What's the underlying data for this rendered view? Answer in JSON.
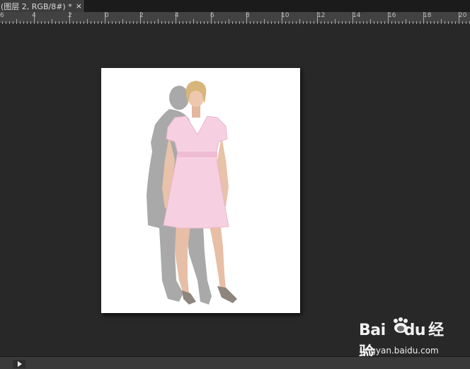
{
  "document_tab": {
    "title": "(图层 2, RGB/8#) *",
    "close_glyph": "×"
  },
  "ruler": {
    "labels": [
      "6",
      "4",
      "2",
      "0",
      "2",
      "4",
      "6",
      "8",
      "10",
      "12",
      "14",
      "16",
      "18",
      "20"
    ]
  },
  "watermark": {
    "brand_text": "Bai",
    "brand_suffix": "du",
    "brand_cn": "经验",
    "url": "jingyan.baidu.com"
  },
  "statusbar": {
    "arrow_icon": "play-arrow-icon"
  },
  "colors": {
    "workspace": "#282828",
    "ruler": "#424242",
    "dress": "#f6cfe0",
    "shadow": "#a8a8a8"
  }
}
